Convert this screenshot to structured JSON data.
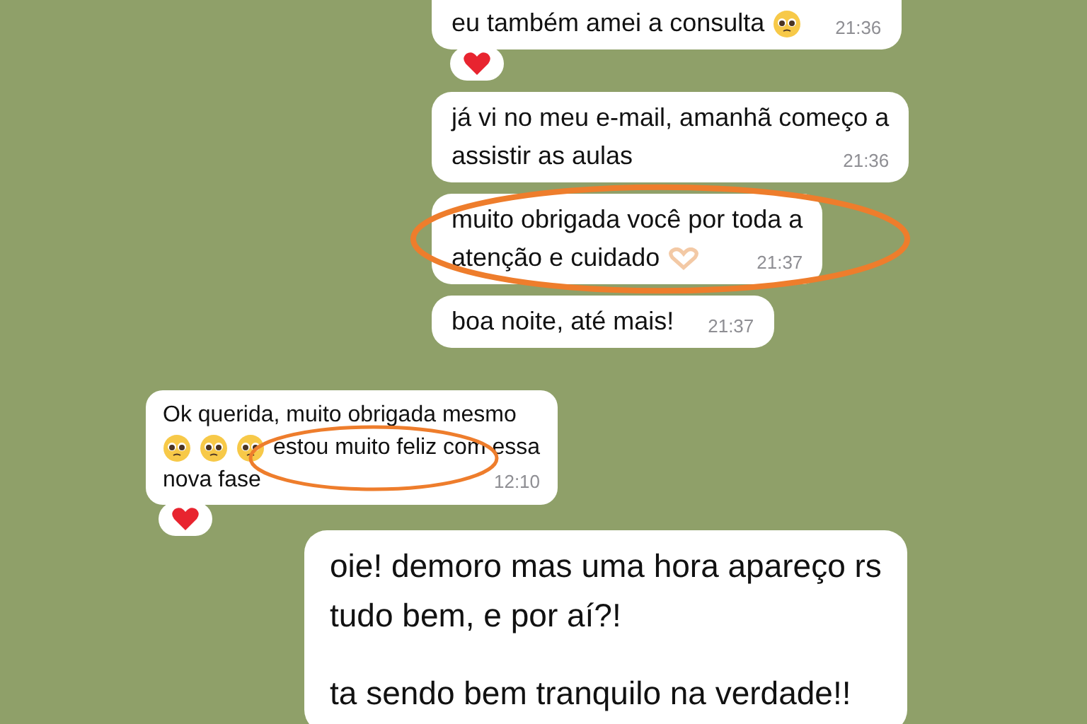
{
  "messages": [
    {
      "kind": "sent",
      "paragraphs": [
        [
          [
            {
              "kind": "text",
              "text": "eu também amei a consulta"
            },
            {
              "kind": "pleading_face"
            }
          ]
        ]
      ],
      "time": "21:36",
      "reactions": [
        {
          "kind": "heart"
        }
      ],
      "circled": false
    },
    {
      "kind": "sent",
      "paragraphs": [
        [
          [
            {
              "kind": "text",
              "text": "já vi no meu e-mail, amanhã começo a"
            }
          ],
          [
            {
              "kind": "text",
              "text": "assistir as aulas"
            }
          ]
        ]
      ],
      "time": "21:36",
      "circled": false
    },
    {
      "kind": "sent",
      "paragraphs": [
        [
          [
            {
              "kind": "text",
              "text": "muito obrigada você por toda a"
            }
          ],
          [
            {
              "kind": "text",
              "text": "atenção e cuidado"
            },
            {
              "kind": "heart_hands"
            }
          ]
        ]
      ],
      "time": "21:37",
      "circled": true
    },
    {
      "kind": "sent",
      "paragraphs": [
        [
          [
            {
              "kind": "text",
              "text": "boa noite, até mais!"
            }
          ]
        ]
      ],
      "time": "21:37",
      "circled": false
    },
    {
      "kind": "received",
      "paragraphs": [
        [
          [
            {
              "kind": "text",
              "text": "Ok querida, muito obrigada mesmo"
            }
          ],
          [
            {
              "kind": "pleading_face"
            },
            {
              "kind": "pleading_face"
            },
            {
              "kind": "pleading_face"
            },
            {
              "kind": "text",
              "text": "estou muito feliz com essa"
            }
          ],
          [
            {
              "kind": "text",
              "text": "nova fase"
            }
          ]
        ]
      ],
      "time": "12:10",
      "reactions": [
        {
          "kind": "heart"
        }
      ],
      "circled": true
    },
    {
      "kind": "large",
      "paragraphs": [
        [
          [
            {
              "kind": "text",
              "text": "oie! demoro mas uma hora apareço rs"
            }
          ],
          [
            {
              "kind": "text",
              "text": "tudo bem, e por aí?!"
            }
          ]
        ],
        [
          [
            {
              "kind": "text",
              "text": "ta sendo bem tranquilo na verdade!!"
            }
          ]
        ]
      ],
      "circled": false
    }
  ]
}
